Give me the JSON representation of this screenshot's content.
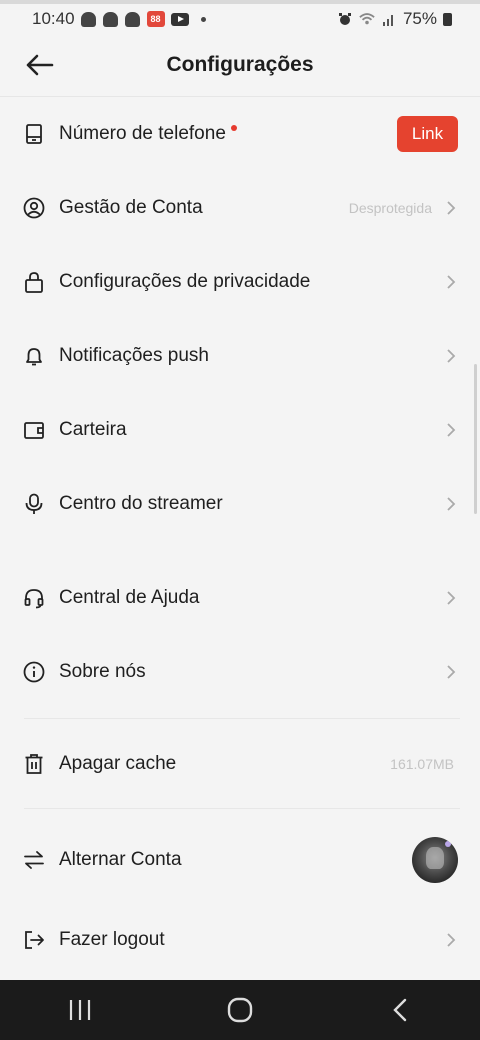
{
  "status_bar": {
    "time": "10:40",
    "battery": "75%",
    "notification_icons": [
      "snapchat-icon",
      "snapchat-icon",
      "snapchat-icon",
      "app-88-icon",
      "youtube-icon",
      "dot-icon"
    ],
    "system_icons": [
      "alarm-icon",
      "wifi-icon",
      "signal-icon",
      "battery-icon"
    ],
    "app_badge_text": "88"
  },
  "header": {
    "title": "Configurações"
  },
  "settings": {
    "phone": {
      "label": "Número de telefone",
      "button": "Link",
      "icon": "phone-icon"
    },
    "account": {
      "label": "Gestão de Conta",
      "value": "Desprotegida",
      "icon": "user-circle-icon"
    },
    "privacy": {
      "label": "Configurações de privacidade",
      "icon": "lock-icon"
    },
    "push": {
      "label": "Notificações push",
      "icon": "bell-icon"
    },
    "wallet": {
      "label": "Carteira",
      "icon": "wallet-icon"
    },
    "streamer": {
      "label": "Centro do streamer",
      "icon": "microphone-icon"
    },
    "help": {
      "label": "Central de Ajuda",
      "icon": "headset-icon"
    },
    "about": {
      "label": "Sobre nós",
      "icon": "info-icon"
    },
    "cache": {
      "label": "Apagar cache",
      "value": "161.07MB",
      "icon": "trash-icon"
    },
    "switch": {
      "label": "Alternar Conta",
      "icon": "swap-icon"
    },
    "logout": {
      "label": "Fazer logout",
      "icon": "logout-icon"
    }
  },
  "colors": {
    "accent": "#e5432f",
    "background": "#f4f4f4",
    "nav_bar": "#1b1b1b"
  }
}
